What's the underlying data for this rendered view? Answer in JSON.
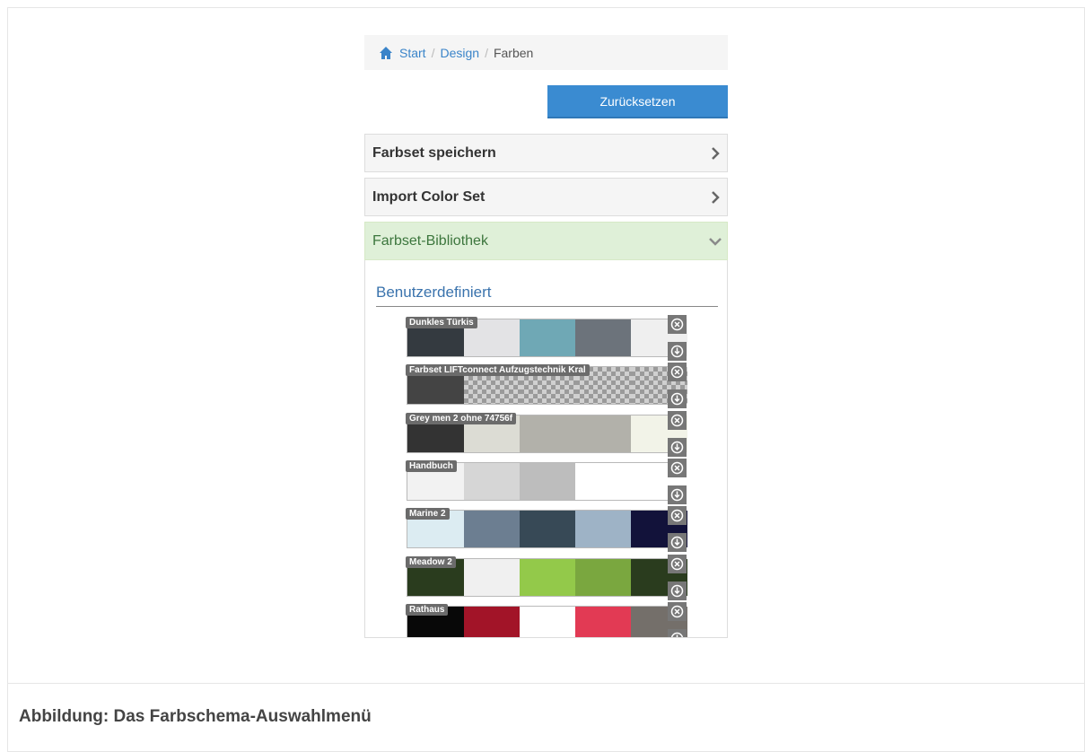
{
  "breadcrumb": {
    "home": "Start",
    "design": "Design",
    "current": "Farben"
  },
  "reset_label": "Zurücksetzen",
  "panels": [
    {
      "title": "Farbset speichern",
      "state": "collapsed"
    },
    {
      "title": "Import Color Set",
      "state": "collapsed"
    },
    {
      "title": "Farbset-Bibliothek",
      "state": "expanded"
    }
  ],
  "library": {
    "section_title": "Benutzerdefiniert",
    "sets": [
      {
        "name": "Dunkles Türkis",
        "colors": [
          "#343a40",
          "#e3e3e5",
          "#6fa8b5",
          "#6c737b",
          "#efefef"
        ]
      },
      {
        "name": "Farbset LIFTconnect Aufzugstechnik Kral",
        "colors": [
          "#444444",
          "checker",
          "checker",
          "checker",
          "checker"
        ]
      },
      {
        "name": "Grey men 2 ohne 74756f",
        "colors": [
          "#333333",
          "#dcdcd4",
          "#b2b1aa",
          "#b2b1aa",
          "#f2f3e8"
        ]
      },
      {
        "name": "Handbuch",
        "colors": [
          "#f2f2f2",
          "#d6d6d6",
          "#bdbdbd",
          "#ffffff",
          "#ffffff"
        ]
      },
      {
        "name": "Marine 2",
        "colors": [
          "#dcecf2",
          "#6c7e91",
          "#374956",
          "#9eb3c6",
          "#12123a"
        ]
      },
      {
        "name": "Meadow 2",
        "colors": [
          "#2a3c1e",
          "#f0f0f0",
          "#93c94a",
          "#7aa73f",
          "#2a3c1e"
        ]
      },
      {
        "name": "Rathaus",
        "colors": [
          "#080808",
          "#a21428",
          "#ffffff",
          "#e23a54",
          "#746f6a"
        ]
      }
    ]
  },
  "caption": "Abbildung: Das Farbschema-Auswahlmenü",
  "colors": {
    "link": "#3a84c9",
    "button": "#3a8bd1",
    "success_bg": "#dff0d8",
    "success_text": "#3c763d"
  }
}
